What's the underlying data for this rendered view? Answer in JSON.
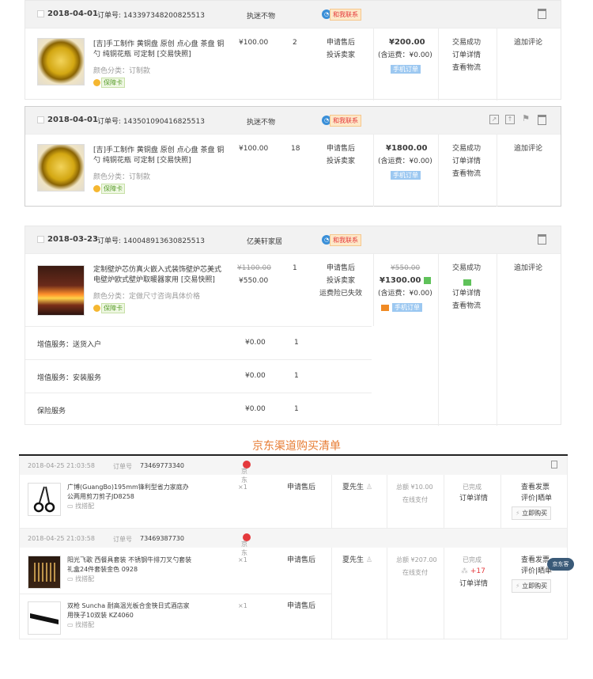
{
  "orders": [
    {
      "date": "2018-04-01",
      "order_no_label": "订单号: 143397348200825513",
      "shop": "执迷不物",
      "contact": "和我联系",
      "item": {
        "title": "[吉]手工制作 黄铜盘 原创 点心盘 茶盘 铜勺 纯铜花瓶 可定制 [交易快照]",
        "spec": "颜色分类：订制款",
        "insurance": "保障卡",
        "price": "¥100.00",
        "qty": "2",
        "after_sale_1": "申请售后",
        "after_sale_2": "投诉卖家",
        "total": "¥200.00",
        "shipping": "(含运费：¥0.00)",
        "mobile": "手机订单",
        "status_1": "交易成功",
        "status_2": "订单详情",
        "status_3": "查看物流",
        "action": "追加评论"
      }
    },
    {
      "date": "2018-04-01",
      "order_no_label": "订单号: 143501090416825513",
      "shop": "执迷不物",
      "contact": "和我联系",
      "item": {
        "title": "[吉]手工制作 黄铜盘 原创 点心盘 茶盘 铜勺 纯铜花瓶 可定制 [交易快照]",
        "spec": "颜色分类：订制款",
        "insurance": "保障卡",
        "price": "¥100.00",
        "qty": "18",
        "after_sale_1": "申请售后",
        "after_sale_2": "投诉卖家",
        "total": "¥1800.00",
        "shipping": "(含运费：¥0.00)",
        "mobile": "手机订单",
        "status_1": "交易成功",
        "status_2": "订单详情",
        "status_3": "查看物流",
        "action": "追加评论"
      }
    },
    {
      "date": "2018-03-23",
      "order_no_label": "订单号: 140048913630825513",
      "shop": "亿美轩家居",
      "contact": "和我联系",
      "item": {
        "title": "定制壁炉芯仿真火嵌入式装饰壁炉芯美式电壁炉欧式壁炉取暖器家用 [交易快照]",
        "spec": "颜色分类：定做尺寸咨询具体价格",
        "insurance": "保障卡",
        "orig_price": "¥1100.00",
        "price": "¥550.00",
        "qty": "1",
        "after_sale_1": "申请售后",
        "after_sale_2": "投诉卖家",
        "after_sale_3": "运费险已失效",
        "orig_total": "¥550.00",
        "total": "¥1300.00",
        "shipping": "(含运费：¥0.00)",
        "mobile": "手机订单",
        "status_1": "交易成功",
        "status_2": "订单详情",
        "status_3": "查看物流",
        "action": "追加评论"
      },
      "services": [
        {
          "name": "增值服务：送货入户",
          "price": "¥0.00",
          "qty": "1"
        },
        {
          "name": "增值服务：安装服务",
          "price": "¥0.00",
          "qty": "1"
        },
        {
          "name": "保险服务",
          "price": "¥0.00",
          "qty": "1"
        }
      ]
    }
  ],
  "jd_section_title": "京东渠道购买清单",
  "jd_orders": [
    {
      "datetime": "2018-04-25 21:03:58",
      "order_no_label": "订单号",
      "order_no": "73469773340",
      "shop": "京东",
      "items": [
        {
          "title": "广博(GuangBo)195mm锋利型省力家庭办公两用剪刀剪子JD8258",
          "match": "找搭配",
          "qty": "×1",
          "after_sale": "申请售后"
        }
      ],
      "receiver": "夏先生",
      "total": "总额 ¥10.00",
      "pay": "在线支付",
      "status": "已完成",
      "detail": "订单详情",
      "invoice": "查看发票",
      "review": "评价|晒单",
      "buy": "立即购买"
    },
    {
      "datetime": "2018-04-25 21:03:58",
      "order_no_label": "订单号",
      "order_no": "73469387730",
      "shop": "京东",
      "items": [
        {
          "title": "阳光飞歌 西餐具套装 不锈钢牛排刀叉勺套装 礼盒24件套装金色 0928",
          "match": "找搭配",
          "qty": "×1",
          "after_sale": "申请售后"
        },
        {
          "title": "双枪 Suncha 耐高温光板合金筷日式酒店家用筷子10双装 KZ4060",
          "match": "找搭配",
          "qty": "×1",
          "after_sale": "申请售后"
        }
      ],
      "receiver": "夏先生",
      "total": "总额 ¥207.00",
      "pay": "在线支付",
      "status": "已完成",
      "points": "+17",
      "detail": "订单详情",
      "invoice": "查看发票",
      "review": "评价|晒单",
      "buy": "立即购买"
    }
  ],
  "chat_label": "京东客"
}
